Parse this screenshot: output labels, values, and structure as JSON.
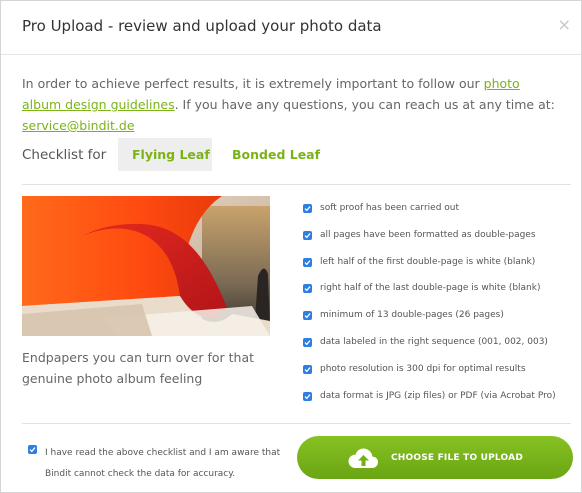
{
  "dialog": {
    "title": "Pro Upload - review and upload your photo data",
    "close_glyph": "×"
  },
  "intro": {
    "text_1": "In order to achieve perfect results, it is extremely important to follow our ",
    "link_guidelines": "photo album design guidelines",
    "text_2": ". If you have any questions, you can reach us at any time at: ",
    "link_email": "service@bindit.de"
  },
  "checklist": {
    "label": "Checklist for",
    "tabs": [
      {
        "label": "Flying Leaf",
        "active": true
      },
      {
        "label": "Bonded Leaf",
        "active": false
      }
    ]
  },
  "photo": {
    "caption": "Endpapers you can turn over for that genuine photo album feeling"
  },
  "checklist_items": [
    {
      "label": "soft proof has been carried out",
      "checked": true
    },
    {
      "label": "all pages have been formatted as double-pages",
      "checked": true
    },
    {
      "label": "left half of the first double-page is white (blank)",
      "checked": true
    },
    {
      "label": "right half of the last double-page is white (blank)",
      "checked": true
    },
    {
      "label": "minimum of 13 double-pages (26 pages)",
      "checked": true
    },
    {
      "label": "data labeled in the right sequence (001, 002, 003)",
      "checked": true
    },
    {
      "label": "photo resolution is 300 dpi for optimal results",
      "checked": true
    },
    {
      "label": "data format is JPG (zip files) or PDF (via Acrobat Pro)",
      "checked": true
    }
  ],
  "agreement": {
    "text": "I have read the above checklist and I am aware that Bindit cannot check the data for accuracy.",
    "checked": true
  },
  "upload": {
    "label": "CHOOSE FILE TO UPLOAD",
    "icon": "cloud-upload-icon"
  },
  "colors": {
    "accent_green": "#7bb317",
    "checkbox_blue": "#2d7ee0"
  }
}
